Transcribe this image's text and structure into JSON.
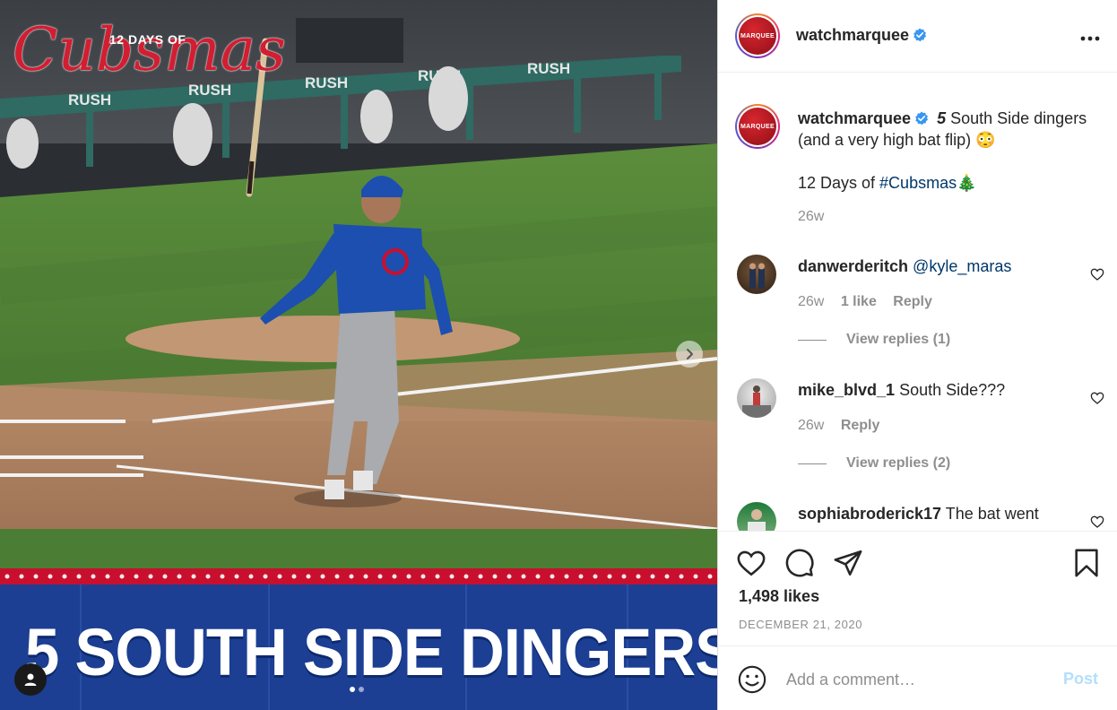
{
  "post": {
    "image": {
      "brand_subtitle": "12 DAYS OF",
      "brand_title": "Cubsmas",
      "headline": "5 SOUTH SIDE DINGERS",
      "carousel_slide": 1,
      "carousel_total": 2
    },
    "author": {
      "username": "watchmarquee",
      "avatar_text": "MARQUEE",
      "verified": true
    },
    "caption": {
      "username": "watchmarquee",
      "text_prefix": "5",
      "text": " South Side dingers (and a very high bat flip) 😳",
      "line2_text": "12 Days of ",
      "hashtag": "#Cubsmas",
      "emoji": "🎄",
      "time": "26w"
    },
    "comments": [
      {
        "username": "danwerderitch",
        "mention": "@kyle_maras",
        "text": "",
        "time": "26w",
        "likes": "1 like",
        "reply": "Reply",
        "view_replies": "View replies (1)"
      },
      {
        "username": "mike_blvd_1",
        "mention": "",
        "text": "South Side???",
        "time": "26w",
        "likes": "",
        "reply": "Reply",
        "view_replies": "View replies (2)"
      },
      {
        "username": "sophiabroderick17",
        "mention": "",
        "text": "The bat went",
        "time": "",
        "likes": "",
        "reply": "",
        "view_replies": ""
      }
    ],
    "likes": "1,498 likes",
    "date": "DECEMBER 21, 2020",
    "add_comment": {
      "placeholder": "Add a comment…",
      "post_label": "Post"
    },
    "icons": {
      "more": "more-options-icon",
      "like": "heart-icon",
      "comment": "comment-icon",
      "share": "send-icon",
      "save": "bookmark-icon",
      "emoji": "emoji-icon",
      "verified": "verified-badge-icon",
      "next": "chevron-right-icon",
      "tagged": "user-tag-icon"
    },
    "colors": {
      "verified": "#3897f0",
      "link": "#00376b",
      "post_disabled": "#b2dffc",
      "muted": "#8e8e8e",
      "brand_red": "#d31d31",
      "banner_blue": "#1c3f94"
    }
  }
}
